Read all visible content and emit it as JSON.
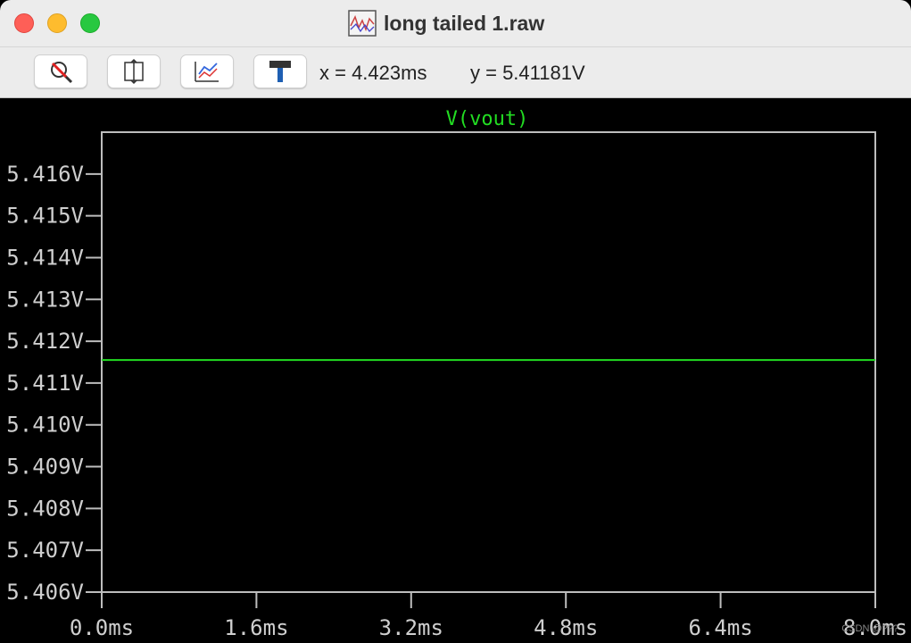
{
  "window": {
    "title": "long tailed 1.raw"
  },
  "toolbar": {
    "buttons": [
      {
        "name": "zoom-cancel-icon"
      },
      {
        "name": "autorange-icon"
      },
      {
        "name": "zoom-back-icon"
      },
      {
        "name": "hammer-icon"
      }
    ],
    "cursor_x": "x = 4.423ms",
    "cursor_y": "y = 5.41181V"
  },
  "colors": {
    "trace": "#22dd22",
    "frame": "#bdbdbd",
    "tick_text": "#cfcfcf",
    "background": "#000000"
  },
  "chart_data": {
    "type": "line",
    "title": "V(vout)",
    "xlabel": "",
    "ylabel": "",
    "x_ticks": [
      "0.0ms",
      "1.6ms",
      "3.2ms",
      "4.8ms",
      "6.4ms",
      "8.0ms"
    ],
    "y_ticks": [
      "5.416V",
      "5.415V",
      "5.414V",
      "5.413V",
      "5.412V",
      "5.411V",
      "5.410V",
      "5.409V",
      "5.408V",
      "5.407V",
      "5.406V"
    ],
    "xlim": [
      0,
      8.0
    ],
    "ylim": [
      5.406,
      5.417
    ],
    "grid": false,
    "series": [
      {
        "name": "V(vout)",
        "x": [
          0.0,
          8.0
        ],
        "y": [
          5.41155,
          5.41155
        ]
      }
    ]
  },
  "watermark": "CSDN @???"
}
